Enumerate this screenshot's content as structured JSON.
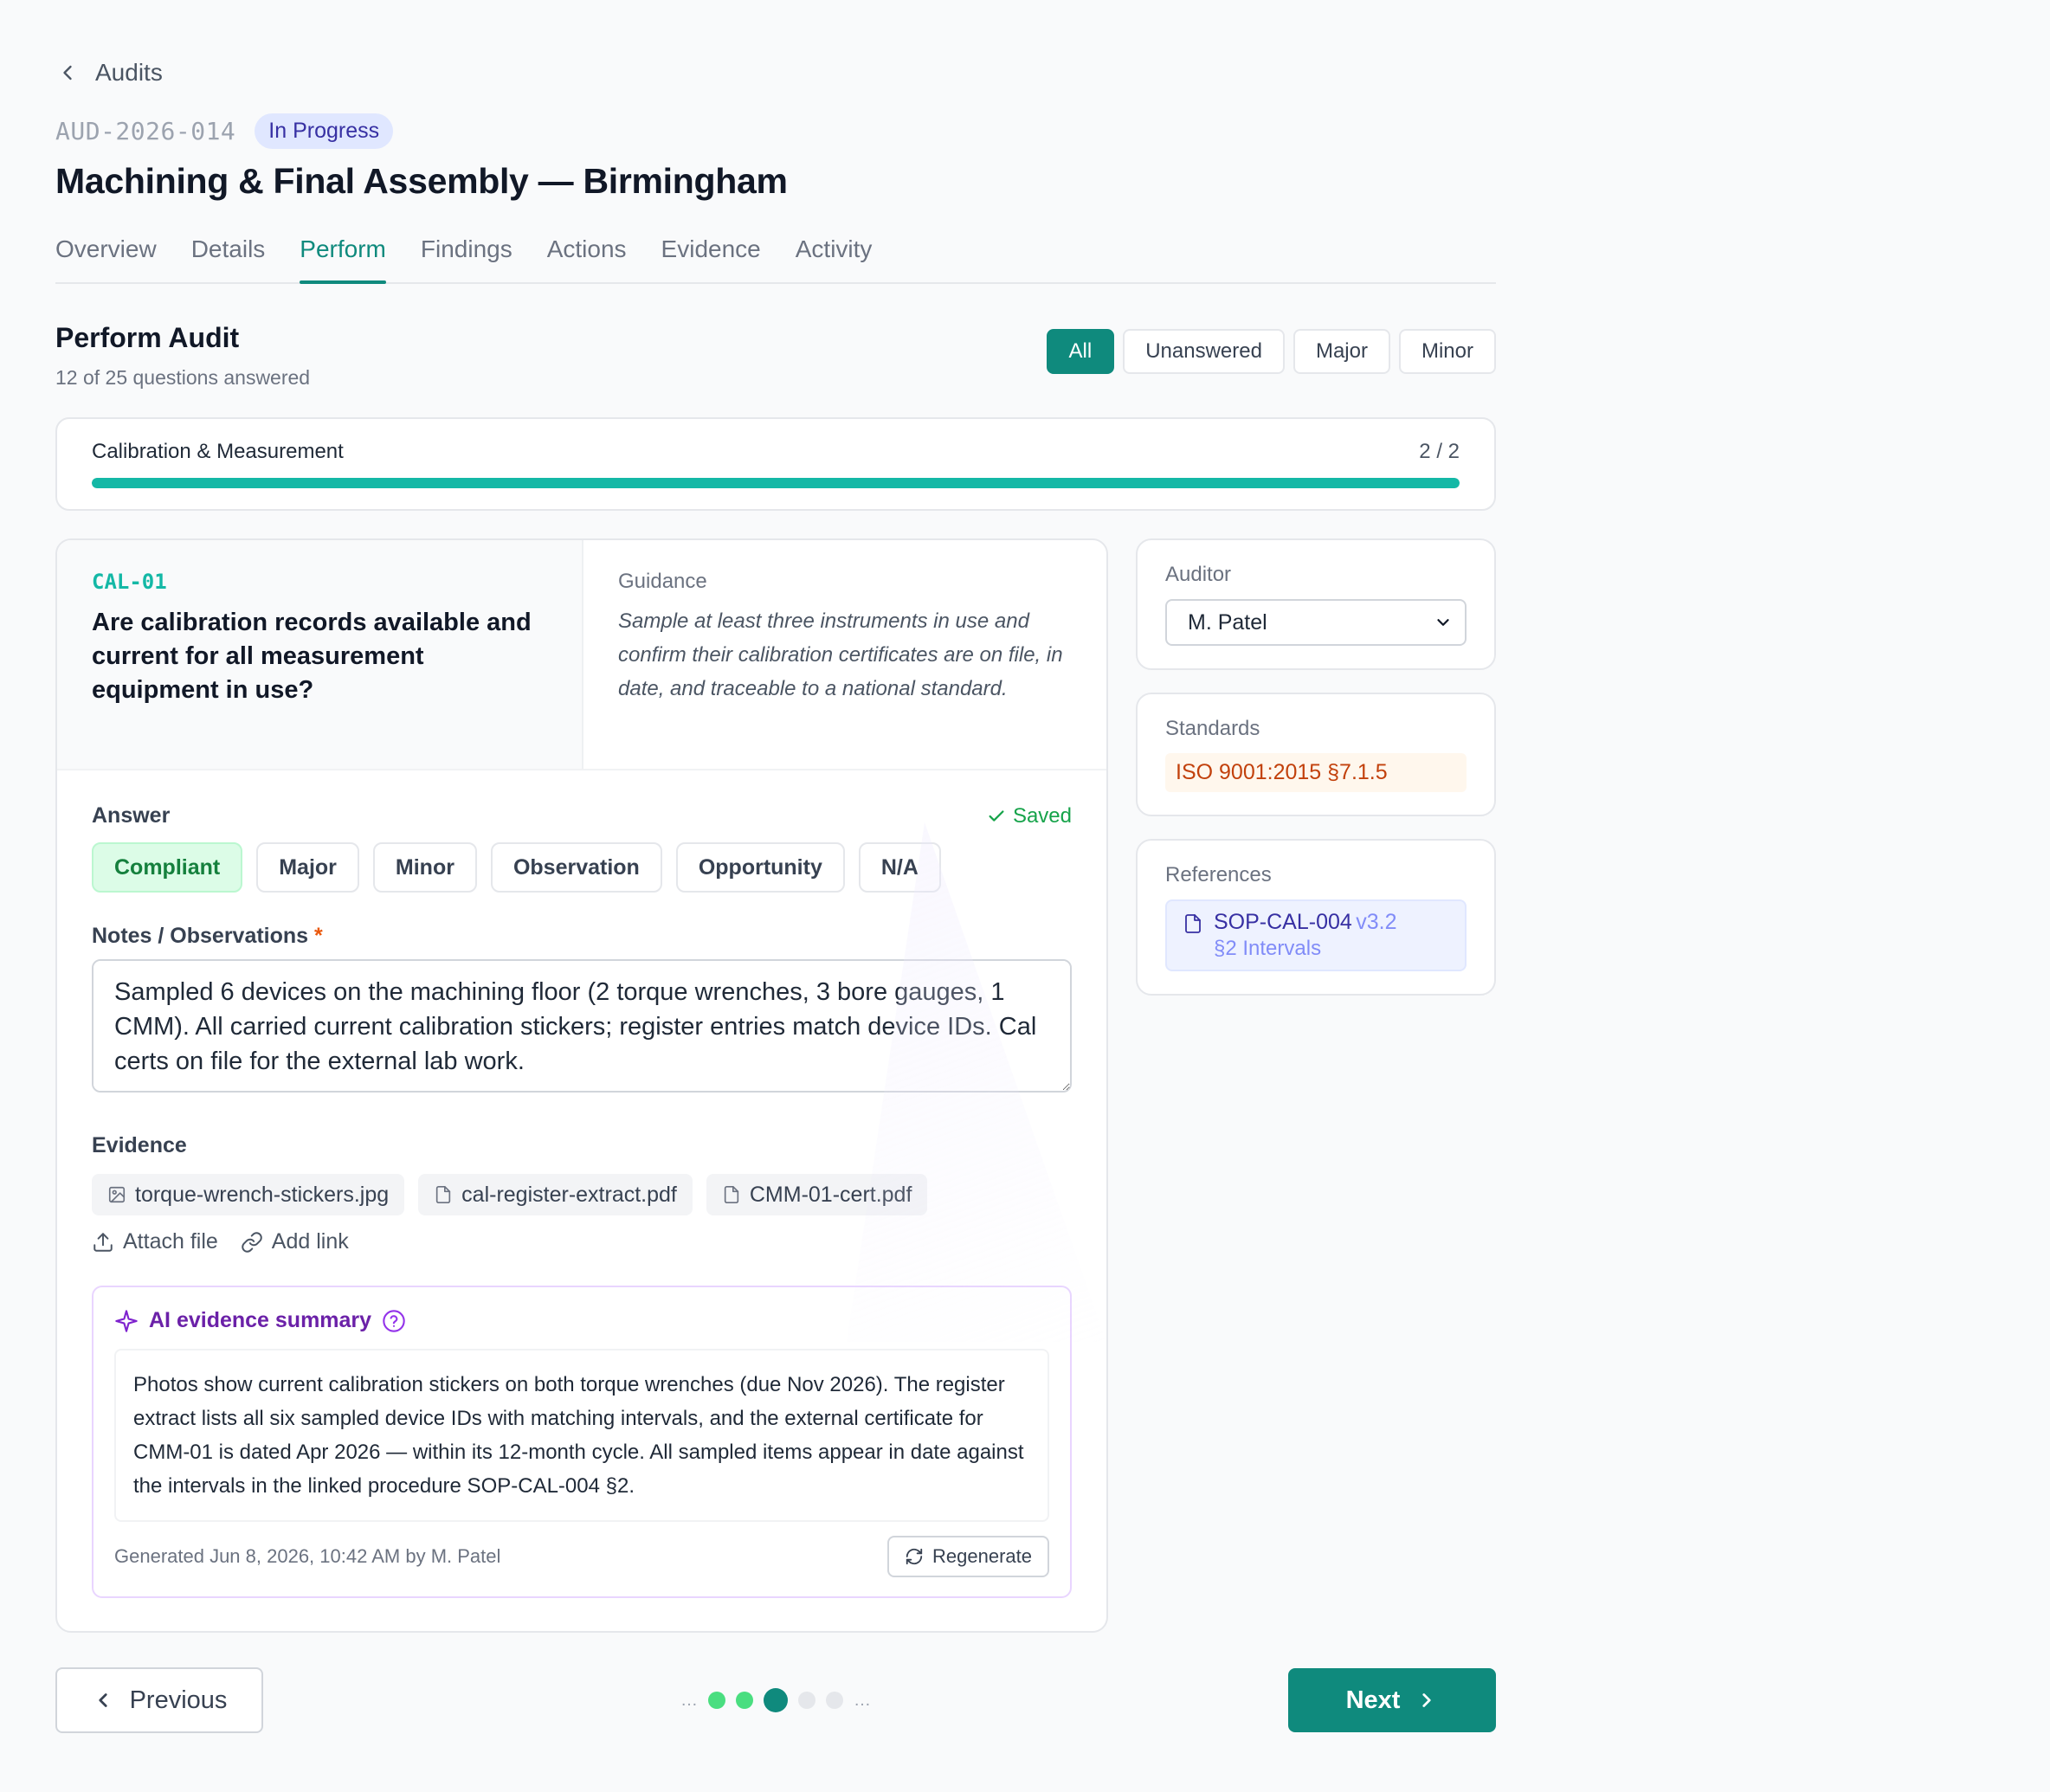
{
  "breadcrumb": {
    "label": "Audits"
  },
  "audit": {
    "id": "AUD-2026-014",
    "status": "In Progress",
    "title": "Machining & Final Assembly — Birmingham"
  },
  "tabs": [
    {
      "label": "Overview"
    },
    {
      "label": "Details"
    },
    {
      "label": "Perform",
      "active": true
    },
    {
      "label": "Findings"
    },
    {
      "label": "Actions"
    },
    {
      "label": "Evidence"
    },
    {
      "label": "Activity"
    }
  ],
  "perform": {
    "title": "Perform Audit",
    "subtitle": "12 of 25 questions answered",
    "filters": [
      "All",
      "Unanswered",
      "Major",
      "Minor"
    ],
    "active_filter": "All"
  },
  "section": {
    "name": "Calibration & Measurement",
    "count": "2 / 2",
    "progress": 1.0
  },
  "question": {
    "code": "CAL-01",
    "text": "Are calibration records available and current for all measurement equipment in use?",
    "guidance_label": "Guidance",
    "guidance": "Sample at least three instruments in use and confirm their calibration certificates are on file, in date, and traceable to a national standard."
  },
  "answer": {
    "label": "Answer",
    "saved": "Saved",
    "options": [
      "Compliant",
      "Major",
      "Minor",
      "Observation",
      "Opportunity",
      "N/A"
    ],
    "selected": "Compliant"
  },
  "notes": {
    "label": "Notes / Observations",
    "required_mark": "*",
    "value": "Sampled 6 devices on the machining floor (2 torque wrenches, 3 bore gauges, 1 CMM). All carried current calibration stickers; register entries match device IDs. Cal certs on file for the external lab work."
  },
  "evidence": {
    "label": "Evidence",
    "files": [
      {
        "name": "torque-wrench-stickers.jpg",
        "icon": "image-icon"
      },
      {
        "name": "cal-register-extract.pdf",
        "icon": "file-icon"
      },
      {
        "name": "CMM-01-cert.pdf",
        "icon": "file-icon"
      }
    ],
    "attach_label": "Attach file",
    "link_label": "Add link"
  },
  "ai_summary": {
    "title": "AI evidence summary",
    "text": "Photos show current calibration stickers on both torque wrenches (due Nov 2026). The register extract lists all six sampled device IDs with matching intervals, and the external certificate for CMM-01 is dated Apr 2026 — within its 12-month cycle. All sampled items appear in date against the intervals in the linked procedure SOP-CAL-004 §2.",
    "generated": "Generated Jun 8, 2026, 10:42 AM by M. Patel",
    "regenerate_label": "Regenerate"
  },
  "sidebar": {
    "auditor_label": "Auditor",
    "auditor_value": "M. Patel",
    "standards_label": "Standards",
    "standard": "ISO 9001:2015 §7.1.5",
    "references_label": "References",
    "reference_id": "SOP-CAL-004",
    "reference_version": "v3.2",
    "reference_section": "§2 Intervals"
  },
  "nav": {
    "previous_label": "Previous",
    "next_label": "Next",
    "ellipsis": "…"
  },
  "colors": {
    "accent": "#0f8a7d",
    "progress": "#14b8a6",
    "compliant_bg": "#dcfce7",
    "ai_purple": "#6b21a8"
  }
}
